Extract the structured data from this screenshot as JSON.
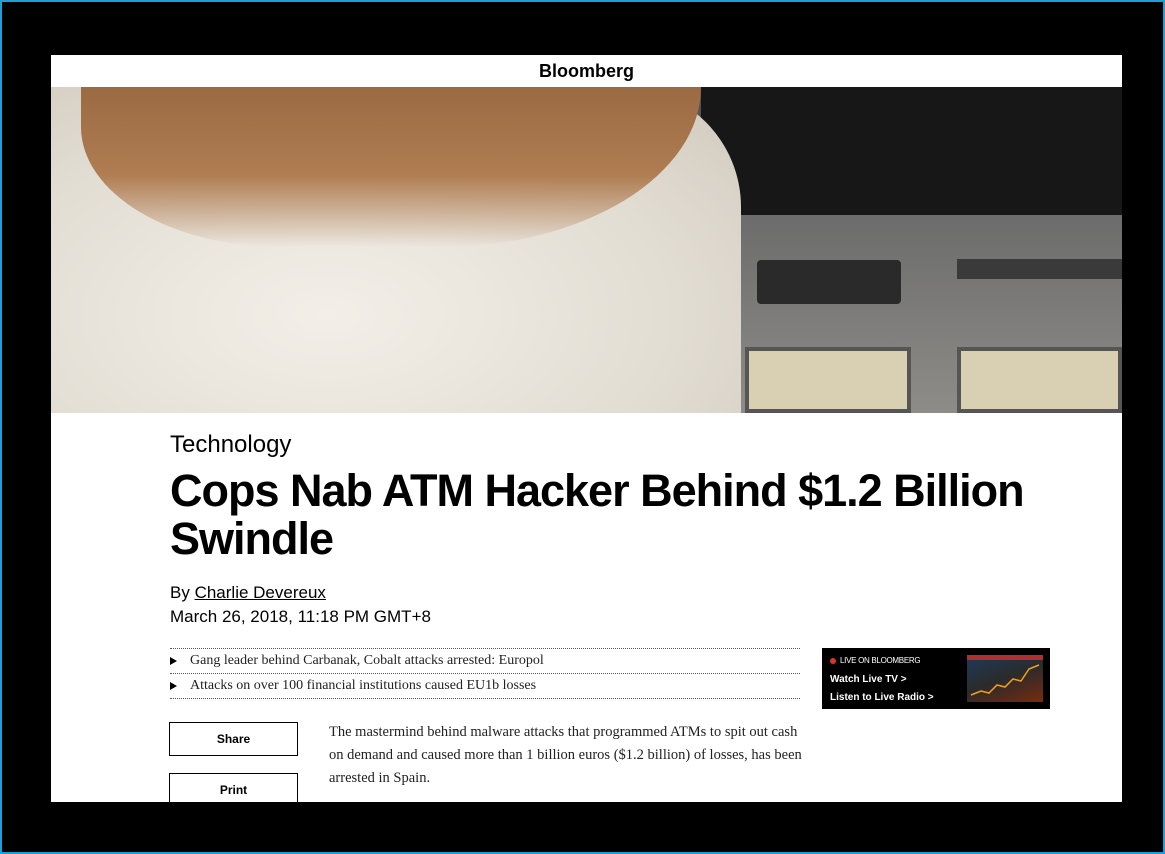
{
  "brand": {
    "name": "Bloomberg"
  },
  "article": {
    "category": "Technology",
    "headline": "Cops Nab ATM Hacker Behind $1.2 Billion Swindle",
    "byline_prefix": "By",
    "author": "Charlie Devereux",
    "date": "March 26, 2018, 11:18 PM GMT+8",
    "bullets": [
      "Gang leader behind Carbanak, Cobalt attacks arrested: Europol",
      "Attacks on over 100 financial institutions caused EU1b losses"
    ],
    "body": "The mastermind behind malware attacks that programmed ATMs to spit out cash on demand and caused more than 1 billion euros ($1.2 billion) of losses, has been arrested in Spain."
  },
  "live_widget": {
    "label": "LIVE ON BLOOMBERG",
    "watch": "Watch Live TV",
    "listen": "Listen to Live Radio",
    "arrow": ">",
    "dot_color": "#e0302a"
  },
  "actions": {
    "share": "Share",
    "print": "Print"
  },
  "colors": {
    "frame": "#1aa0d8",
    "background": "#000000"
  }
}
